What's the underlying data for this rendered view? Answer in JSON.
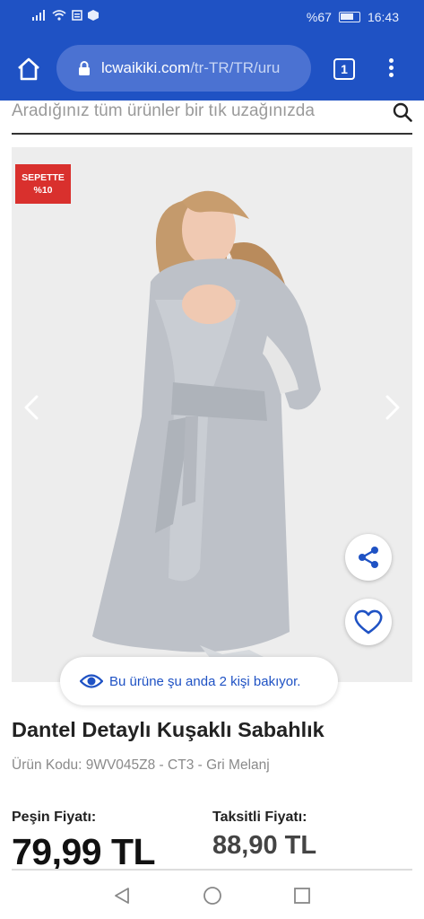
{
  "status_bar": {
    "battery_percent": "%67",
    "time": "16:43"
  },
  "browser": {
    "url_host": "lcwaikiki.com",
    "url_path": "/tr-TR/TR/uru",
    "tab_count": "1"
  },
  "search": {
    "placeholder": "Aradığınız tüm ürünler bir tık uzağınızda"
  },
  "product": {
    "badge_line1": "SEPETTE",
    "badge_line2": "%10",
    "viewers_text": "Bu ürüne şu anda 2 kişi bakıyor.",
    "title": "Dantel Detaylı Kuşaklı Sabahlık",
    "code_line": "Ürün Kodu: 9WV045Z8 - CT3 - Gri Melanj"
  },
  "prices": {
    "cash_label": "Peşin Fiyatı:",
    "cash_value": "79,99 TL",
    "installment_label": "Taksitli Fiyatı:",
    "installment_value": "88,90 TL"
  },
  "colors": {
    "brand_blue": "#1f52c4",
    "badge_red": "#d9302d",
    "image_bg": "#ededed"
  },
  "icons": [
    "home-icon",
    "lock-icon",
    "tabs-icon",
    "more-vert-icon",
    "search-icon",
    "chevron-left-icon",
    "chevron-right-icon",
    "share-icon",
    "heart-icon",
    "eye-icon",
    "nav-back-icon",
    "nav-home-icon",
    "nav-recents-icon"
  ]
}
